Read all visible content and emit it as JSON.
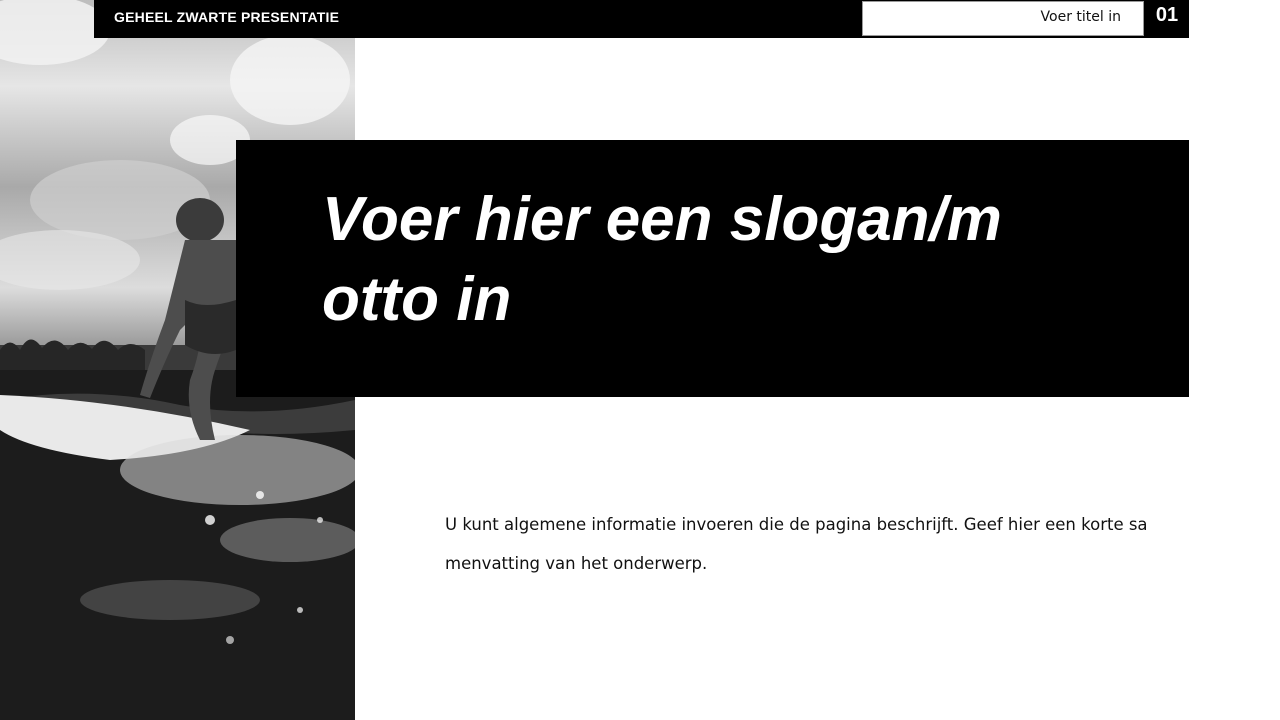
{
  "header": {
    "presentation_title": "GEHEEL ZWARTE PRESENTATIE",
    "title_placeholder": "Voer titel in",
    "page_number": "01"
  },
  "slide": {
    "slogan": "Voer hier een slogan/motto in",
    "description": "U kunt algemene informatie invoeren die de pagina beschrijft. Geef hier een korte samenvatting van het onderwerp."
  },
  "image": {
    "subject": "surfer-photo",
    "style": "black-and-white"
  },
  "colors": {
    "band": "#000000",
    "background": "#ffffff",
    "text_on_dark": "#ffffff",
    "text": "#111111"
  }
}
